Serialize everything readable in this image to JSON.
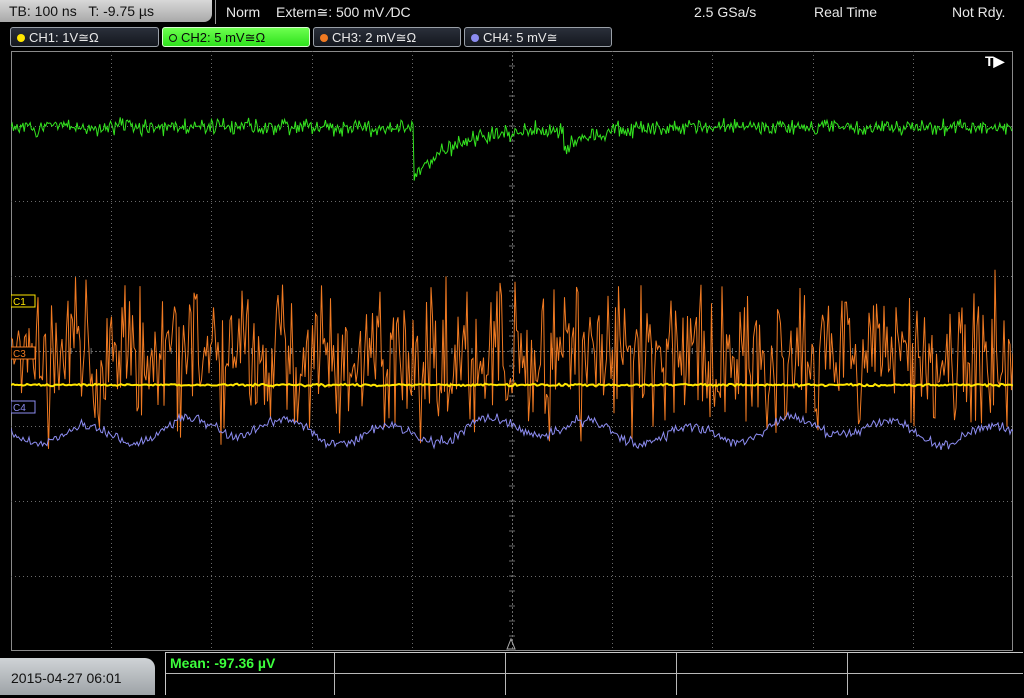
{
  "status": {
    "timebase": "TB: 100 ns",
    "trigger_time": "T: -9.75 µs",
    "mode": "Norm",
    "trigger_source": "Extern≅: 500 mV ⁄DC",
    "sample_rate": "2.5 GSa/s",
    "acquisition": "Real Time",
    "state": "Not Rdy."
  },
  "channels": [
    {
      "label": "CH1: 1V≅Ω",
      "color": "#ffe600",
      "active": false
    },
    {
      "label": "CH2: 5 mV≅Ω",
      "color": "#33e31f",
      "active": true
    },
    {
      "label": "CH3: 2 mV≅Ω",
      "color": "#f07a22",
      "active": false
    },
    {
      "label": "CH4: 5 mV≅",
      "color": "#8c8cf0",
      "active": false
    }
  ],
  "markers": {
    "c1": "C1",
    "c3": "C3",
    "c4": "C4",
    "trigger": "T▶"
  },
  "measurement": {
    "mean": "Mean: -97.36 µV"
  },
  "datetime": "2015-04-27 06:01",
  "colors": {
    "grid": "#6a6a6a",
    "ch1": "#ffe600",
    "ch2": "#33e31f",
    "ch3": "#f07a22",
    "ch4": "#8c8cf0"
  }
}
